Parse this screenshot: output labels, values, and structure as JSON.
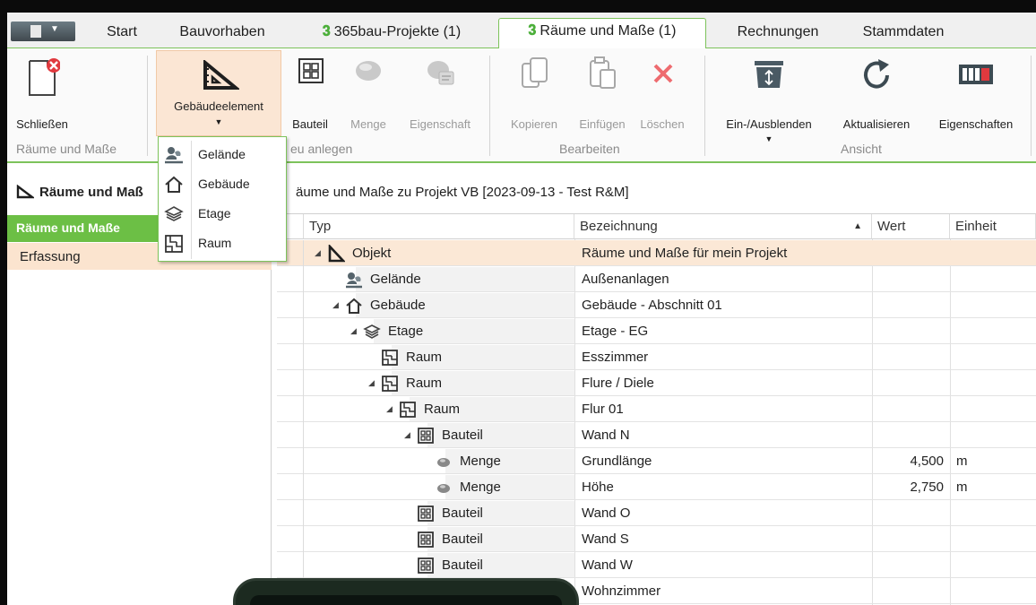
{
  "tabs": [
    {
      "label": "Start"
    },
    {
      "label": "Bauvorhaben"
    },
    {
      "label": "365bau-Projekte (1)"
    },
    {
      "label": "Räume und Maße (1)"
    },
    {
      "label": "Rechnungen"
    },
    {
      "label": "Stammdaten"
    }
  ],
  "ribbon": {
    "schliessen": "Schließen",
    "gebaeudeelement": "Gebäudeelement",
    "bauteil": "Bauteil",
    "menge": "Menge",
    "eigenschaft": "Eigenschaft",
    "kopieren": "Kopieren",
    "einfuegen": "Einfügen",
    "loeschen": "Löschen",
    "ein_ausblenden": "Ein-/Ausblenden",
    "aktualisieren": "Aktualisieren",
    "eigenschaften": "Eigenschaften",
    "groups": {
      "raeume": "Räume und Maße",
      "neu": "eu anlegen",
      "bearbeiten": "Bearbeiten",
      "ansicht": "Ansicht"
    }
  },
  "dropdown": [
    {
      "label": "Gelände"
    },
    {
      "label": "Gebäude"
    },
    {
      "label": "Etage"
    },
    {
      "label": "Raum"
    }
  ],
  "leftnav": {
    "header": "Räume und Maß",
    "active": "Räume und Maße",
    "sub": "Erfassung"
  },
  "grid": {
    "title": "äume und Maße zu Projekt VB [2023-09-13 - Test R&M]",
    "columns": {
      "typ": "Typ",
      "bezeichnung": "Bezeichnung",
      "wert": "Wert",
      "einheit": "Einheit"
    },
    "rows": [
      {
        "typ": "Objekt",
        "bez": "Räume und Maße für mein Projekt",
        "wert": "",
        "einheit": ""
      },
      {
        "typ": "Gelände",
        "bez": "Außenanlagen",
        "wert": "",
        "einheit": ""
      },
      {
        "typ": "Gebäude",
        "bez": "Gebäude - Abschnitt 01",
        "wert": "",
        "einheit": ""
      },
      {
        "typ": "Etage",
        "bez": "Etage - EG",
        "wert": "",
        "einheit": ""
      },
      {
        "typ": "Raum",
        "bez": "Esszimmer",
        "wert": "",
        "einheit": ""
      },
      {
        "typ": "Raum",
        "bez": "Flure / Diele",
        "wert": "",
        "einheit": ""
      },
      {
        "typ": "Raum",
        "bez": "Flur 01",
        "wert": "",
        "einheit": ""
      },
      {
        "typ": "Bauteil",
        "bez": "Wand N",
        "wert": "",
        "einheit": ""
      },
      {
        "typ": "Menge",
        "bez": "Grundlänge",
        "wert": "4,500",
        "einheit": "m"
      },
      {
        "typ": "Menge",
        "bez": "Höhe",
        "wert": "2,750",
        "einheit": "m"
      },
      {
        "typ": "Bauteil",
        "bez": "Wand O",
        "wert": "",
        "einheit": ""
      },
      {
        "typ": "Bauteil",
        "bez": "Wand S",
        "wert": "",
        "einheit": ""
      },
      {
        "typ": "Bauteil",
        "bez": "Wand W",
        "wert": "",
        "einheit": ""
      },
      {
        "typ": "",
        "bez": "Wohnzimmer",
        "wert": "",
        "einheit": ""
      }
    ]
  },
  "colors": {
    "accent": "#6cbf45",
    "selected_row": "#fbe8d6",
    "error": "#e0393e"
  }
}
